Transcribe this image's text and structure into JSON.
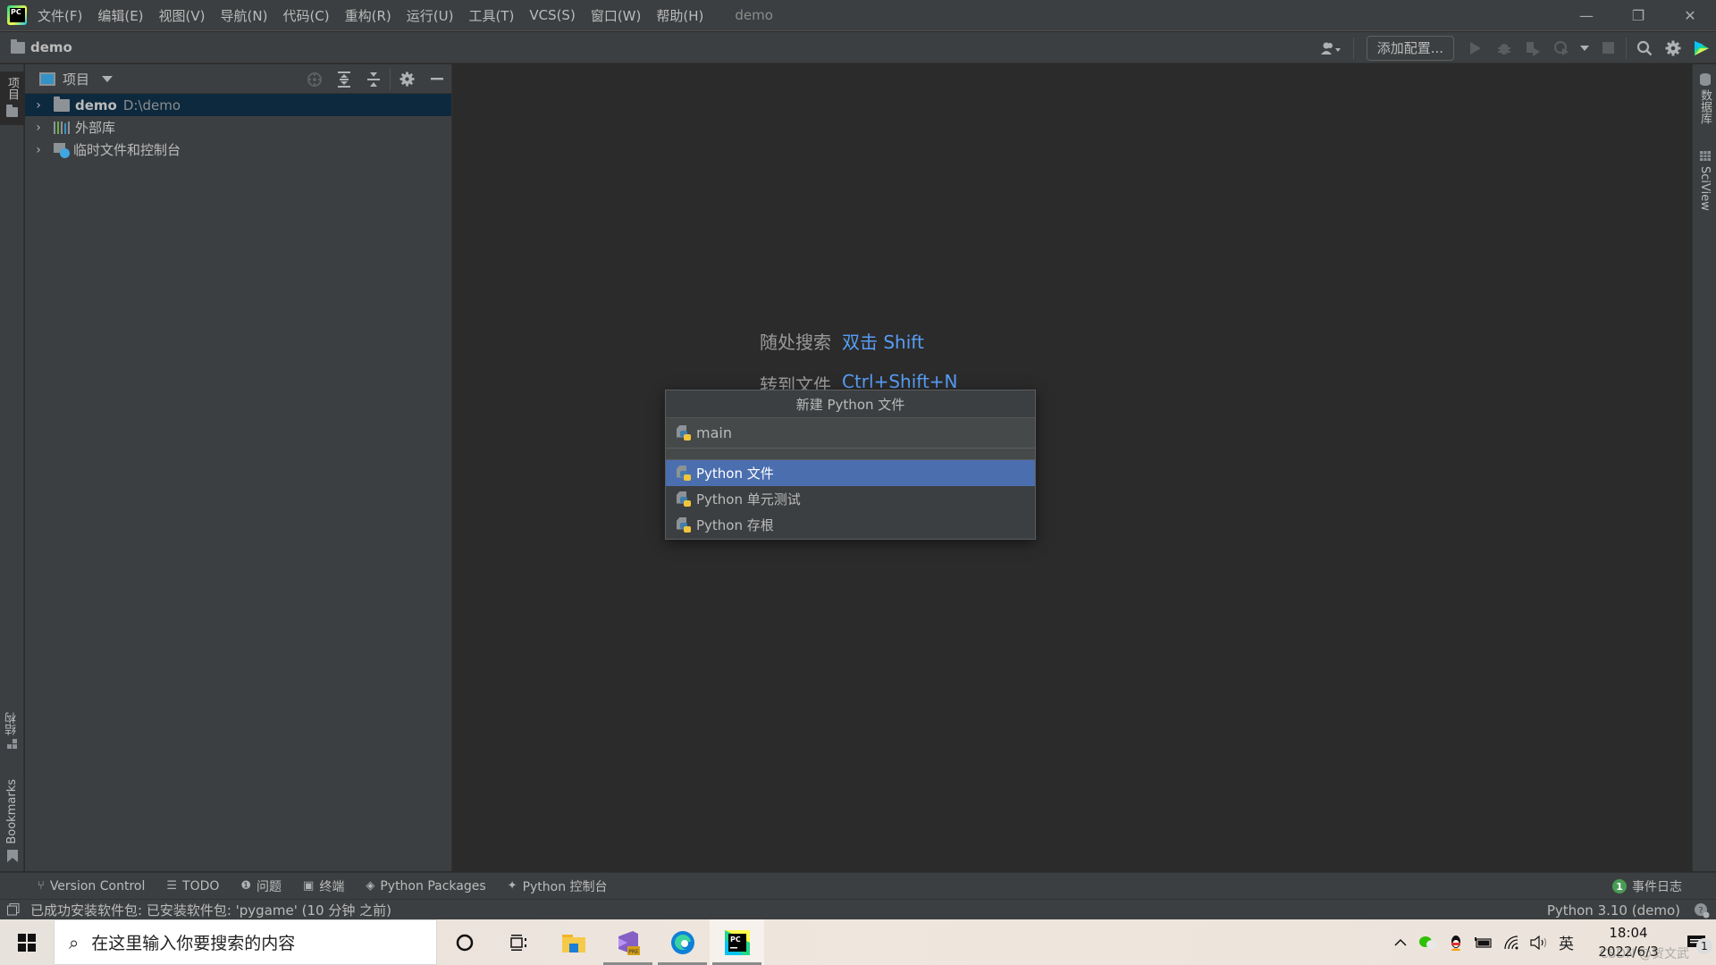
{
  "titlebar": {
    "menu": [
      "文件(F)",
      "编辑(E)",
      "视图(V)",
      "导航(N)",
      "代码(C)",
      "重构(R)",
      "运行(U)",
      "工具(T)",
      "VCS(S)",
      "窗口(W)",
      "帮助(H)"
    ],
    "window_title": "demo",
    "controls": {
      "minimize": "—",
      "restore": "❐",
      "close": "✕"
    }
  },
  "navbar": {
    "breadcrumb": "demo",
    "add_config_label": "添加配置...",
    "icons": [
      "user-icon",
      "run-icon",
      "debug-icon",
      "coverage-icon",
      "profile-icon",
      "stop-icon",
      "search-icon",
      "settings-icon",
      "toolbox-icon"
    ]
  },
  "left_strip": {
    "project_tab": "项目",
    "structure_tab": "结构",
    "bookmarks_tab": "Bookmarks"
  },
  "right_strip": {
    "database_tab": "数据库",
    "sciview_tab": "SciView"
  },
  "project_panel": {
    "header_label": "项目",
    "tree": [
      {
        "name": "demo",
        "path": "D:\\demo",
        "icon": "folder-icon",
        "selected": true
      },
      {
        "name": "外部库",
        "icon": "library-icon",
        "selected": false
      },
      {
        "name": "临时文件和控制台",
        "icon": "scratch-icon",
        "selected": false
      }
    ]
  },
  "editor": {
    "hints": [
      {
        "label": "随处搜索",
        "shortcut": "双击 Shift"
      },
      {
        "label": "转到文件",
        "shortcut": "Ctrl+Shift+N"
      }
    ]
  },
  "dialog": {
    "title": "新建 Python 文件",
    "input_value": "main",
    "options": [
      {
        "label": "Python 文件",
        "selected": true
      },
      {
        "label": "Python 单元测试",
        "selected": false
      },
      {
        "label": "Python 存根",
        "selected": false
      }
    ]
  },
  "bottom_tools": {
    "items": [
      {
        "icon": "⑂",
        "label": "Version Control"
      },
      {
        "icon": "☰",
        "label": "TODO"
      },
      {
        "icon": "❶",
        "label": "问题"
      },
      {
        "icon": "▣",
        "label": "终端"
      },
      {
        "icon": "◈",
        "label": "Python Packages"
      },
      {
        "icon": "✦",
        "label": "Python 控制台"
      }
    ],
    "event_log": {
      "count": "1",
      "label": "事件日志"
    }
  },
  "statusbar": {
    "message": "已成功安装软件包: 已安装软件包: 'pygame' (10 分钟 之前)",
    "interpreter": "Python 3.10 (demo)"
  },
  "taskbar": {
    "search_placeholder": "在这里输入你要搜索的内容",
    "time": "18:04",
    "date": "2022/6/3",
    "ime": "英",
    "watermark": "CSDN @贺文武",
    "notification_count": "1"
  },
  "colors": {
    "accent_link": "#589df6",
    "selection": "#4b6eaf",
    "tree_selection": "#0d293e",
    "badge_green": "#499c54"
  }
}
